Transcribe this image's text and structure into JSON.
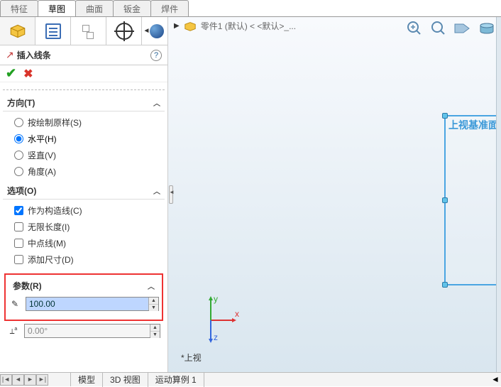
{
  "tabs": [
    "特征",
    "草图",
    "曲面",
    "钣金",
    "焊件"
  ],
  "active_tab": 1,
  "breadcrumb": "零件1 (默认) < <默认>_...",
  "cmd_title": "插入线条",
  "sections": {
    "direction": {
      "title": "方向(T)",
      "options": [
        "按绘制原样(S)",
        "水平(H)",
        "竖直(V)",
        "角度(A)"
      ],
      "selected": 1
    },
    "options": {
      "title": "选项(O)",
      "items": [
        {
          "label": "作为构造线(C)",
          "checked": true
        },
        {
          "label": "无限长度(I)",
          "checked": false
        },
        {
          "label": "中点线(M)",
          "checked": false
        },
        {
          "label": "添加尺寸(D)",
          "checked": false
        }
      ]
    },
    "params": {
      "title": "参数(R)",
      "length": "100.00",
      "angle": "0.00°"
    }
  },
  "plane_label": "上视基准面",
  "view_name": "*上视",
  "bottom_tabs": [
    "模型",
    "3D 视图",
    "运动算例 1"
  ],
  "axes_labels": {
    "x": "x",
    "y": "y",
    "z": "z"
  }
}
